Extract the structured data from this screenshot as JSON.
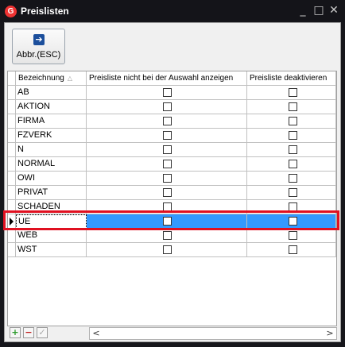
{
  "window": {
    "title": "Preislisten",
    "app_icon_glyph": "G",
    "minimize_glyph": "_",
    "maximize_glyph": "□",
    "close_glyph": "✕"
  },
  "toolbar": {
    "abbr_label": "Abbr.(ESC)",
    "abbr_icon": "exit-arrow-icon"
  },
  "grid": {
    "columns": [
      "Bezeichnung",
      "Preisliste nicht bei der Auswahl anzeigen",
      "Preisliste deaktivieren"
    ],
    "sort_glyph": "△",
    "rows": [
      {
        "name": "AB",
        "hide": false,
        "deactivate": false
      },
      {
        "name": "AKTION",
        "hide": false,
        "deactivate": false
      },
      {
        "name": "FIRMA",
        "hide": false,
        "deactivate": false
      },
      {
        "name": "FZVERK",
        "hide": false,
        "deactivate": false
      },
      {
        "name": "N",
        "hide": false,
        "deactivate": false
      },
      {
        "name": "NORMAL",
        "hide": false,
        "deactivate": false
      },
      {
        "name": "OWI",
        "hide": false,
        "deactivate": false
      },
      {
        "name": "PRIVAT",
        "hide": false,
        "deactivate": false
      },
      {
        "name": "SCHADEN",
        "hide": false,
        "deactivate": false
      },
      {
        "name": "UE",
        "hide": false,
        "deactivate": false,
        "selected": true
      },
      {
        "name": "WEB",
        "hide": false,
        "deactivate": false
      },
      {
        "name": "WST",
        "hide": false,
        "deactivate": false
      }
    ]
  },
  "navigator": {
    "add_glyph": "+",
    "delete_glyph": "−",
    "confirm_glyph": "✓",
    "scroll_left_glyph": "<",
    "scroll_right_glyph": ">"
  },
  "colors": {
    "selection": "#3399ff",
    "highlight_frame": "#e01020",
    "titlebar": "#141419"
  }
}
